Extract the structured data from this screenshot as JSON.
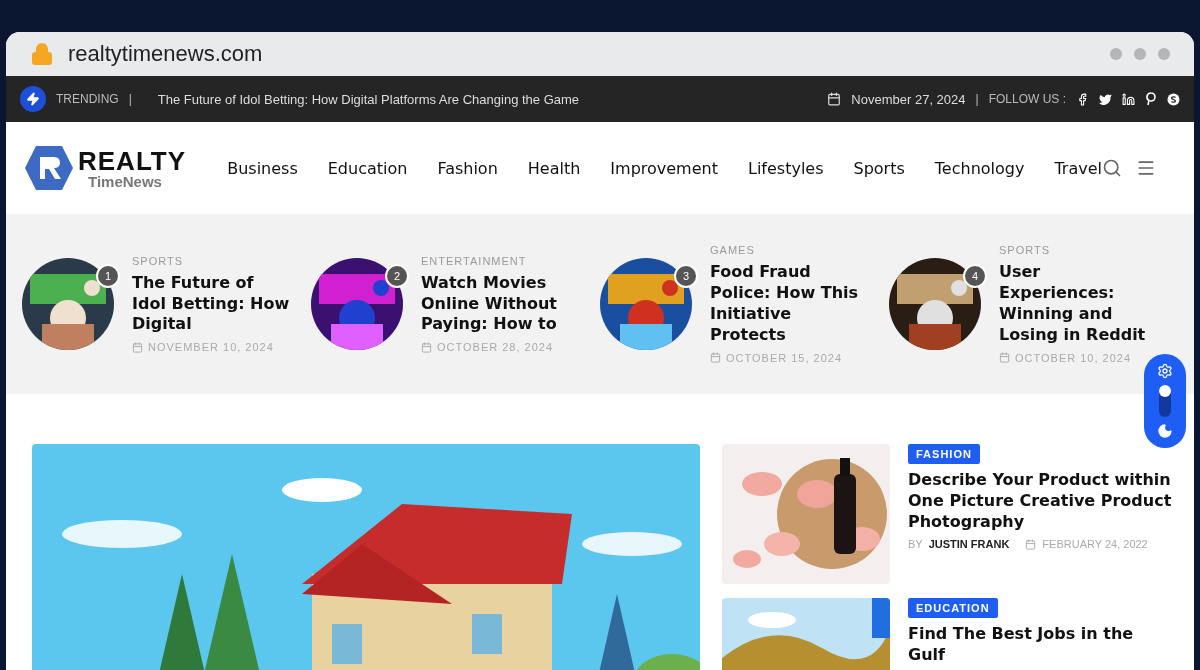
{
  "browser": {
    "url": "realtytimenews.com"
  },
  "topbar": {
    "trending_label": "TRENDING",
    "separator": "|",
    "headline": "The Future of Idol Betting: How Digital Platforms Are Changing the Game",
    "date": "November 27, 2024",
    "separator_2": "|",
    "follow_label": "FOLLOW US :"
  },
  "logo": {
    "line_1": "REALTY",
    "line_2": "TimeNews"
  },
  "nav": [
    "Business",
    "Education",
    "Fashion",
    "Health",
    "Improvement",
    "Lifestyles",
    "Sports",
    "Technology",
    "Travel"
  ],
  "featured": [
    {
      "number": "1",
      "category": "SPORTS",
      "title": "The Future of Idol Betting: How Digital",
      "date": "NOVEMBER 10, 2024"
    },
    {
      "number": "2",
      "category": "ENTERTAINMENT",
      "title": "Watch Movies Online Without Paying: How to",
      "date": "OCTOBER 28, 2024"
    },
    {
      "number": "3",
      "category": "GAMES",
      "title": "Food Fraud Police: How This Initiative Protects",
      "date": "OCTOBER 15, 2024"
    },
    {
      "number": "4",
      "category": "SPORTS",
      "title": "User Experiences: Winning and Losing in Reddit",
      "date": "OCTOBER 10, 2024"
    }
  ],
  "posts": [
    {
      "category": "FASHION",
      "title": "Describe Your Product within One Picture Creative Product Photography",
      "by": "BY",
      "author": "JUSTIN FRANK",
      "date": "FEBRUARY 24, 2022"
    },
    {
      "category": "EDUCATION",
      "title": "Find The Best Jobs in the Gulf"
    }
  ],
  "widget": {
    "dark_mode": false
  }
}
